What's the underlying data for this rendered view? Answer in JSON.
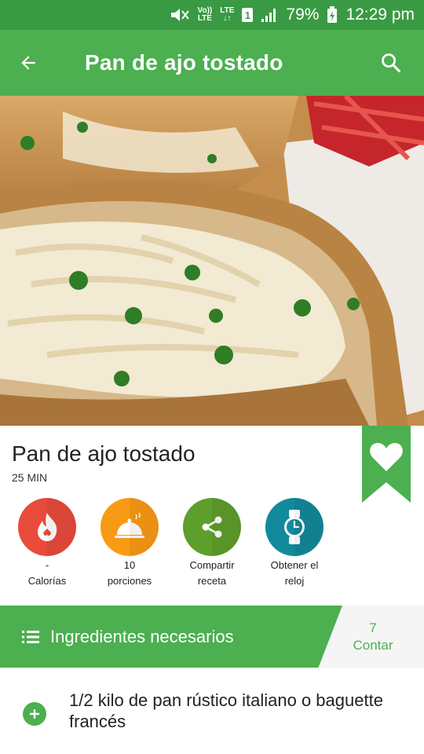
{
  "status_bar": {
    "volte_top": "Vo))",
    "volte_bottom": "LTE",
    "lte_top": "LTE",
    "lte_bottom": "↓↑",
    "sim": "1",
    "battery": "79%",
    "time": "12:29 pm"
  },
  "app_bar": {
    "title": "Pan de ajo tostado",
    "back_icon": "arrow-left-icon",
    "search_icon": "search-icon"
  },
  "recipe": {
    "title": "Pan de ajo tostado",
    "time": "25 MIN",
    "favorite_icon": "heart-icon"
  },
  "actions": [
    {
      "icon": "calories-flame-icon",
      "value": "-",
      "label": "Calorías",
      "color": "#e84b3c"
    },
    {
      "icon": "serving-dish-icon",
      "value": "10",
      "label": "porciones",
      "color": "#f99a14"
    },
    {
      "icon": "share-icon",
      "value": "Compartir",
      "label": "receta",
      "color": "#5e9e2b"
    },
    {
      "icon": "watch-icon",
      "value": "Obtener el",
      "label": "reloj",
      "color": "#138a9c"
    }
  ],
  "ingredients": {
    "header": "Ingredientes necesarios",
    "count": "7",
    "count_label": "Contar",
    "items": [
      "1/2 kilo de pan rústico italiano o baguette francés"
    ]
  },
  "colors": {
    "primary": "#4caf50",
    "status_bar": "#3a9a43"
  }
}
